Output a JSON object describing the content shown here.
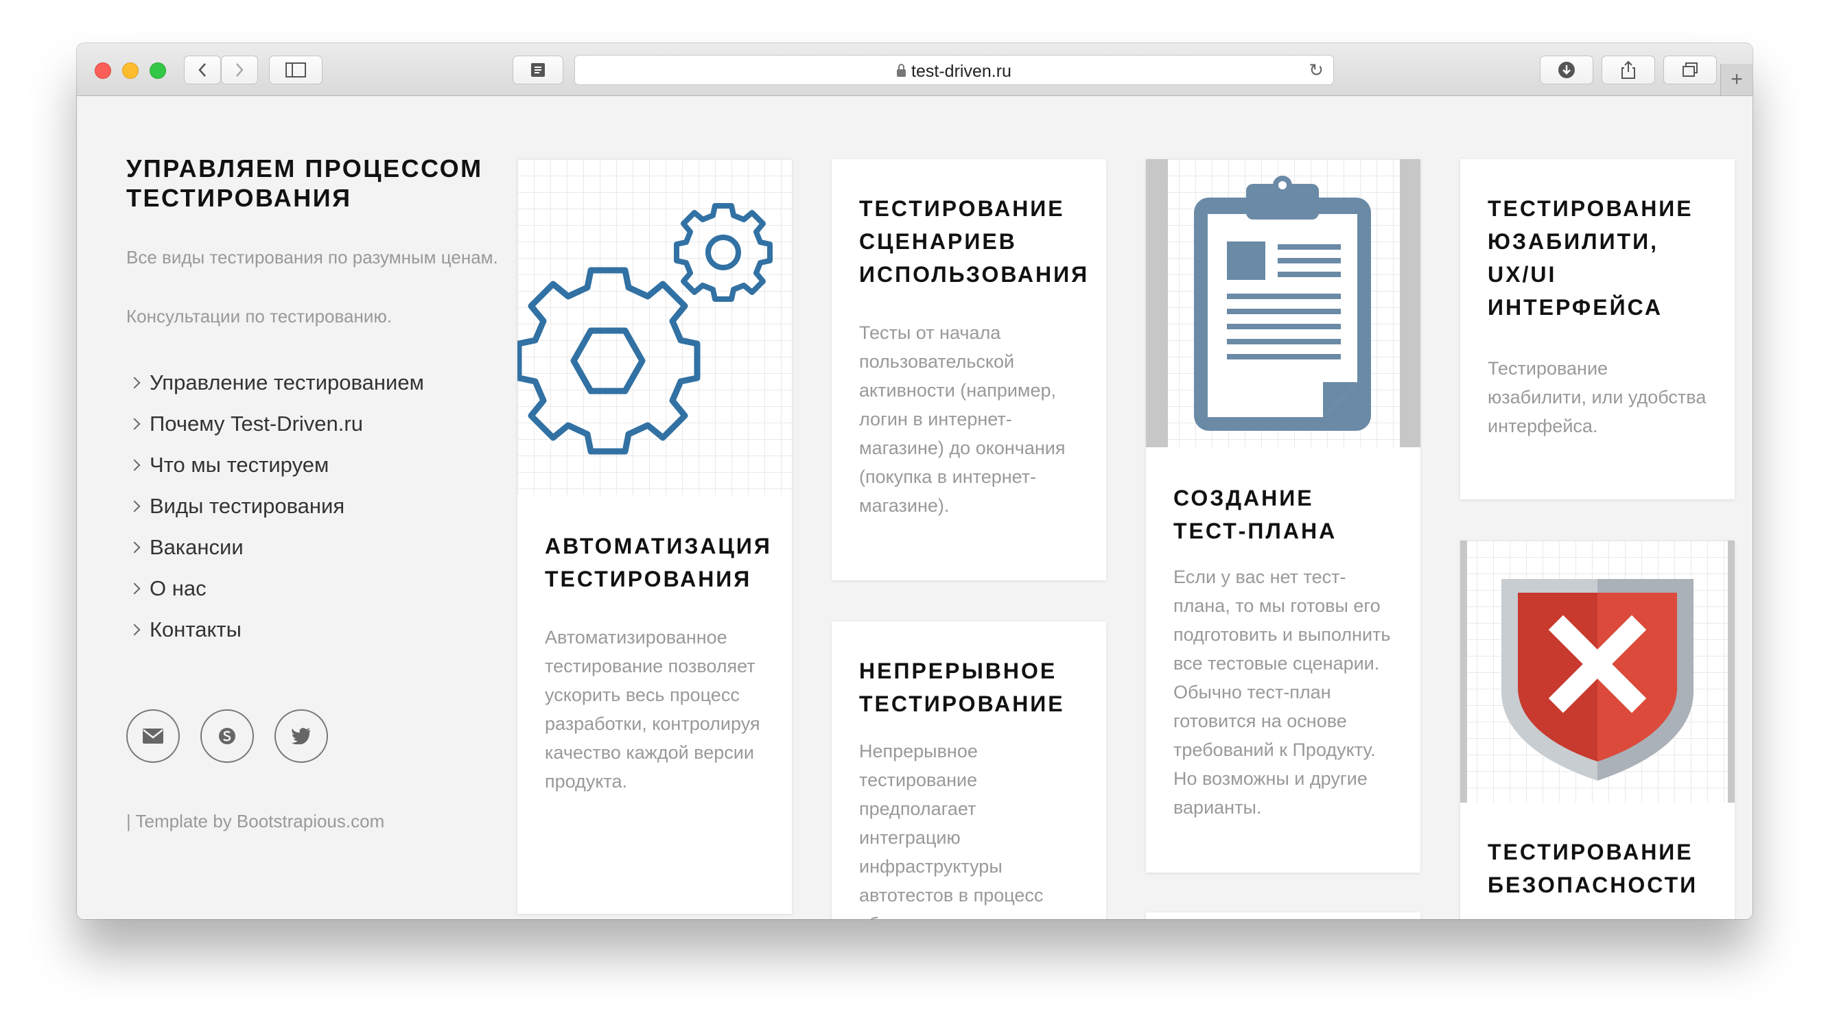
{
  "browser": {
    "url": "test-driven.ru",
    "icons": {
      "back": "chevron-left-icon",
      "forward": "chevron-right-icon",
      "sidebar": "sidebar-icon",
      "reader": "reader-icon",
      "reload": "reload-icon",
      "download": "download-icon",
      "share": "share-icon",
      "tabs": "tabs-icon",
      "new_tab": "plus-icon"
    }
  },
  "sidebar": {
    "title": "УПРАВЛЯЕМ ПРОЦЕССОМ ТЕСТИРОВАНИЯ",
    "description": "Все виды тестирования по разумным ценам.",
    "consult": "Консультации по тестированию.",
    "nav": [
      {
        "label": "Управление тестированием"
      },
      {
        "label": "Почему Test-Driven.ru"
      },
      {
        "label": "Что мы тестируем"
      },
      {
        "label": "Виды тестирования"
      },
      {
        "label": "Вакансии"
      },
      {
        "label": "О нас"
      },
      {
        "label": "Контакты"
      }
    ],
    "socials": [
      "email-icon",
      "skype-icon",
      "twitter-icon"
    ],
    "credit": "| Template by Bootstrapious.com"
  },
  "cards": [
    {
      "title": "АВТОМАТИЗАЦИЯ ТЕСТИРОВАНИЯ",
      "text": "Автоматизированное тестирование позволяет ускорить весь процесс разработки, контролируя качество каждой версии продукта.",
      "icon": "gears-icon"
    },
    {
      "title": "ТЕСТИРОВАНИЕ СЦЕНАРИЕВ ИСПОЛЬЗОВАНИЯ",
      "text": "Тесты от начала пользовательской активности (например, логин в интернет-магазине) до окончания (покупка в интернет-магазине)."
    },
    {
      "title": "НЕПРЕРЫВНОЕ ТЕСТИРОВАНИЕ",
      "text": "Непрерывное тестирование предполагает интеграцию инфраструктуры автотестов в процесс сборки продукта"
    },
    {
      "title": "СОЗДАНИЕ ТЕСТ-ПЛАНА",
      "text": "Если у вас нет тест-плана, то мы готовы его подготовить и выполнить все тестовые сценарии. Обычно тест-план готовится на основе требований к Продукту. Но возможны и другие варианты.",
      "icon": "clipboard-icon"
    },
    {
      "title": "ТЕСТИРОВАНИЕ ЮЗАБИЛИТИ, UX/UI ИНТЕРФЕЙСА",
      "text": "Тестирование юзабилити, или удобства интерфейса."
    },
    {
      "title": "ТЕСТИРОВАНИЕ БЕЗОПАСНОСТИ",
      "icon": "shield-x-icon"
    }
  ],
  "colors": {
    "gear": "#3271a3",
    "clipboard": "#6a8aa6",
    "shield_red": "#c8392e",
    "shield_silver": "#c8cdd2"
  }
}
